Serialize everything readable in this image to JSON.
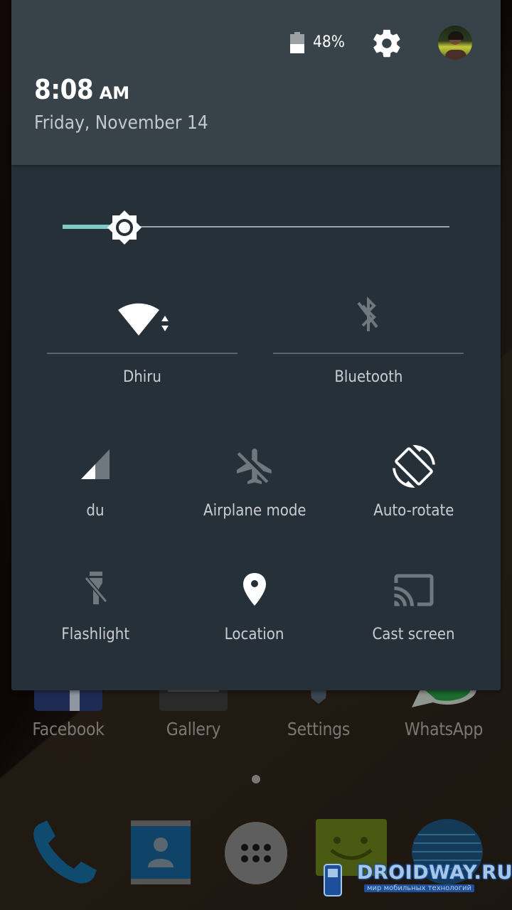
{
  "status_header": {
    "battery": {
      "icon": "battery-icon",
      "level_percent": 48,
      "label": "48%"
    },
    "settings_icon": "gear-icon",
    "avatar_icon": "user-avatar",
    "time": "8:08",
    "ampm": "AM",
    "date": "Friday, November 14"
  },
  "brightness": {
    "icon": "brightness-icon",
    "level_fraction": 0.16,
    "accent_color": "#80cbc4"
  },
  "tiles_large": [
    {
      "id": "wifi",
      "icon": "wifi-icon",
      "label": "Dhiru",
      "enabled": true
    },
    {
      "id": "bluetooth",
      "icon": "bluetooth-off-icon",
      "label": "Bluetooth",
      "enabled": false
    }
  ],
  "tiles_small": [
    {
      "id": "cellular",
      "icon": "cellular-signal-icon",
      "label": "du",
      "enabled": true
    },
    {
      "id": "airplane",
      "icon": "airplane-off-icon",
      "label": "Airplane mode",
      "enabled": false
    },
    {
      "id": "autorotate",
      "icon": "screen-rotation-icon",
      "label": "Auto-rotate",
      "enabled": true
    },
    {
      "id": "flashlight",
      "icon": "flashlight-off-icon",
      "label": "Flashlight",
      "enabled": false
    },
    {
      "id": "location",
      "icon": "location-pin-icon",
      "label": "Location",
      "enabled": true
    },
    {
      "id": "cast",
      "icon": "cast-icon",
      "label": "Cast screen",
      "enabled": false
    }
  ],
  "home_apps": [
    {
      "label": "Facebook",
      "icon": "facebook-icon"
    },
    {
      "label": "Gallery",
      "icon": "gallery-icon"
    },
    {
      "label": "Settings",
      "icon": "settings-app-icon"
    },
    {
      "label": "WhatsApp",
      "icon": "whatsapp-icon"
    }
  ],
  "page_indicator": {
    "pages": 1,
    "current": 1
  },
  "dock": [
    {
      "label": "Phone",
      "icon": "phone-icon"
    },
    {
      "label": "Contacts",
      "icon": "contacts-icon"
    },
    {
      "label": "Apps",
      "icon": "app-drawer-icon"
    },
    {
      "label": "Messaging",
      "icon": "messaging-icon"
    },
    {
      "label": "Browser",
      "icon": "browser-globe-icon"
    }
  ],
  "watermark": {
    "title": "DROIDWAY.RU",
    "subtitle": "мир мобильных технологий"
  },
  "colors": {
    "panel_bg": "#263039",
    "header_bg": "#384249",
    "icon_active": "#ffffff",
    "icon_inactive": "#6f787e",
    "label": "#c9cdd0"
  }
}
